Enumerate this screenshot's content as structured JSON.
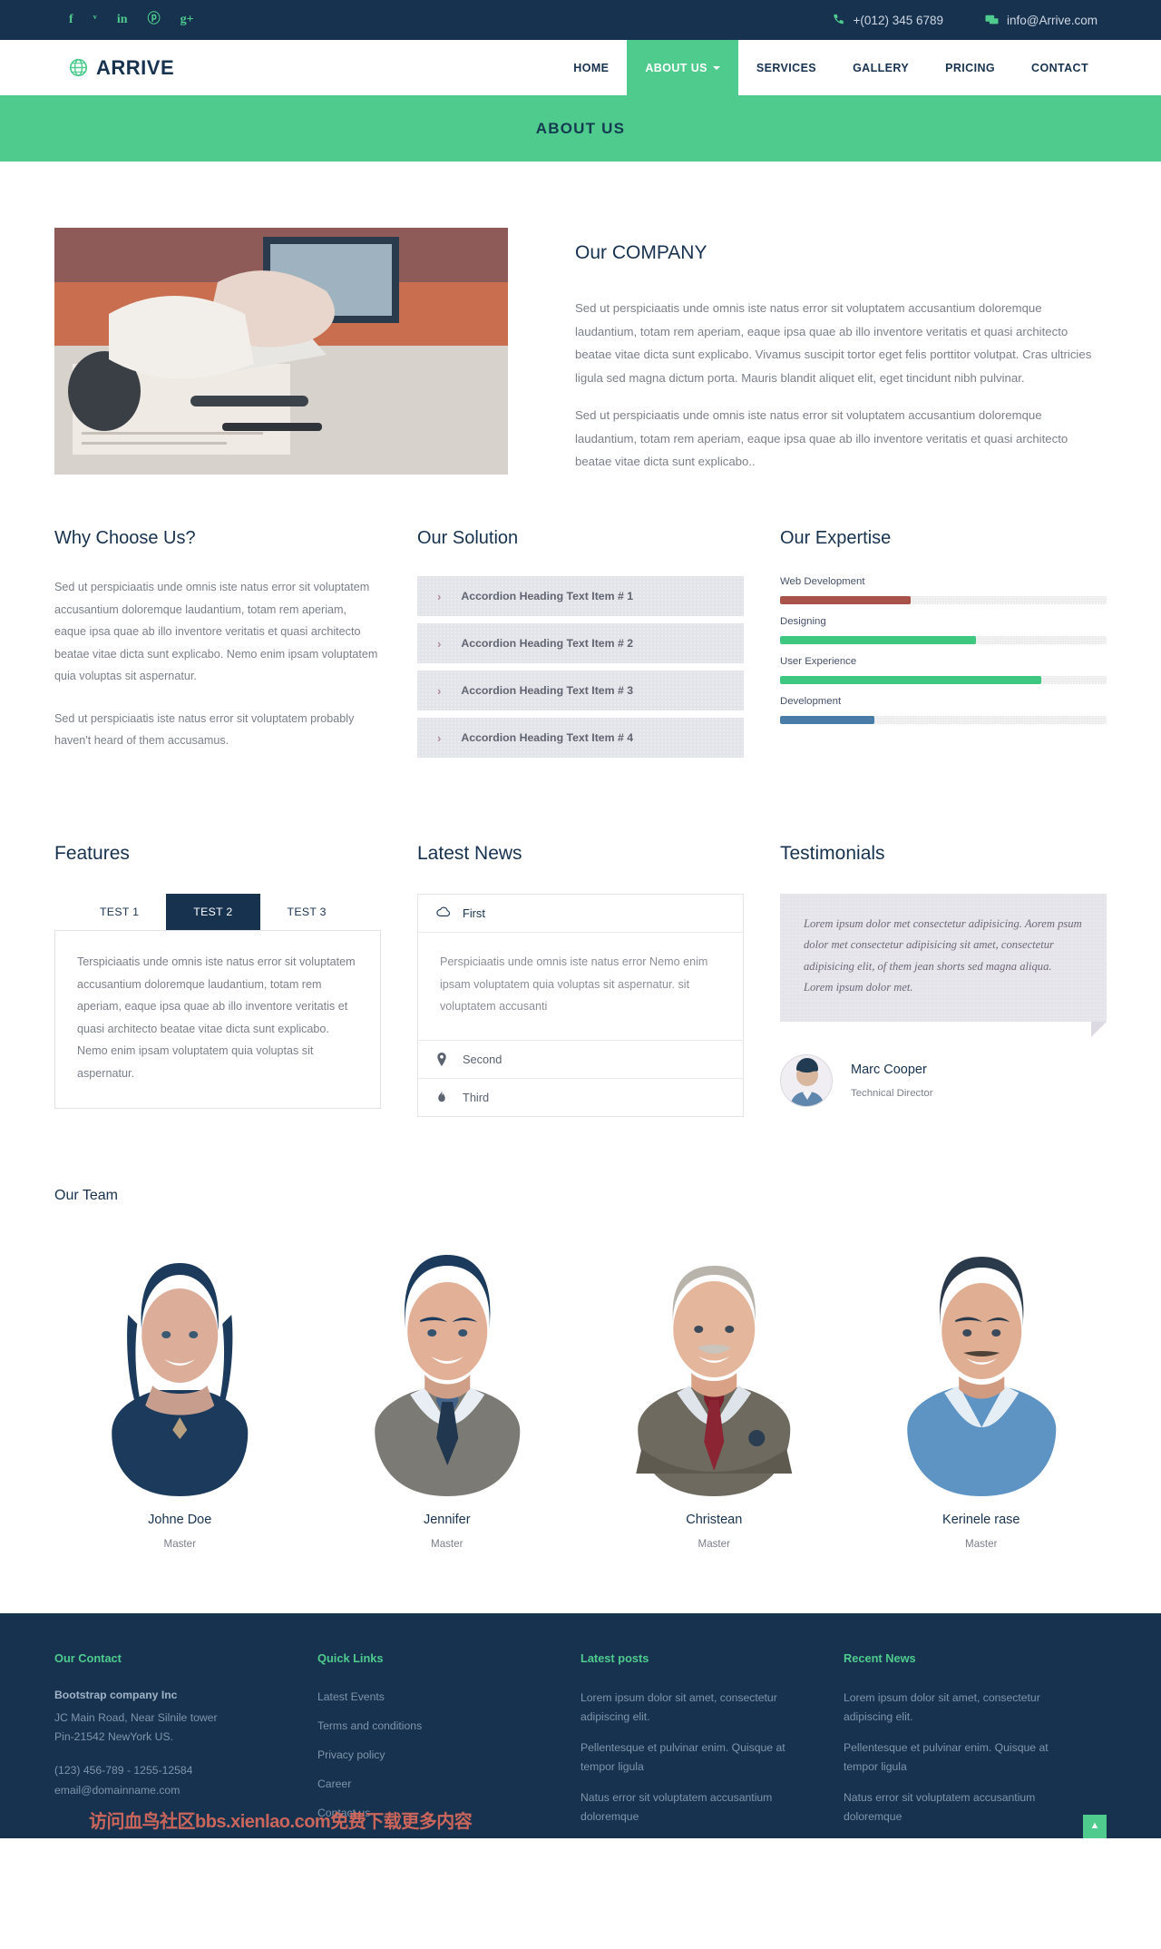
{
  "topbar": {
    "social": [
      {
        "name": "facebook-icon",
        "glyph": "f"
      },
      {
        "name": "twitter-icon",
        "glyph": "ᵛ"
      },
      {
        "name": "linkedin-icon",
        "glyph": "in"
      },
      {
        "name": "pinterest-icon",
        "glyph": "ⓟ"
      },
      {
        "name": "googleplus-icon",
        "glyph": "g+"
      }
    ],
    "phone": "+(012) 345 6789",
    "email": "info@Arrive.com",
    "phone_icon": "phone-icon",
    "email_icon": "message-icon"
  },
  "navbar": {
    "brand": "ARRIVE",
    "brand_icon": "globe-icon",
    "menu": [
      {
        "label": "HOME",
        "active": false,
        "caret": false
      },
      {
        "label": "ABOUT US",
        "active": true,
        "caret": true
      },
      {
        "label": "SERVICES",
        "active": false,
        "caret": false
      },
      {
        "label": "GALLERY",
        "active": false,
        "caret": false
      },
      {
        "label": "PRICING",
        "active": false,
        "caret": false
      },
      {
        "label": "CONTACT",
        "active": false,
        "caret": false
      }
    ]
  },
  "banner": {
    "title": "ABOUT US"
  },
  "company": {
    "title": "Our COMPANY",
    "paragraph1": "Sed ut perspiciaatis unde omnis iste natus error sit voluptatem accusantium doloremque laudantium, totam rem aperiam, eaque ipsa quae ab illo inventore veritatis et quasi architecto beatae vitae dicta sunt explicabo. Vivamus suscipit tortor eget felis porttitor volutpat. Cras ultricies ligula sed magna dictum porta. Mauris blandit aliquet elit, eget tincidunt nibh pulvinar.",
    "paragraph2": "Sed ut perspiciaatis unde omnis iste natus error sit voluptatem accusantium doloremque laudantium, totam rem aperiam, eaque ipsa quae ab illo inventore veritatis et quasi architecto beatae vitae dicta sunt explicabo.."
  },
  "why": {
    "title": "Why Choose Us?",
    "paragraph1": "Sed ut perspiciaatis unde omnis iste natus error sit voluptatem accusantium doloremque laudantium, totam rem aperiam, eaque ipsa quae ab illo inventore veritatis et quasi architecto beatae vitae dicta sunt explicabo. Nemo enim ipsam voluptatem quia voluptas sit aspernatur.",
    "paragraph2": "Sed ut perspiciaatis iste natus error sit voluptatem probably haven't heard of them accusamus."
  },
  "solution": {
    "title": "Our Solution",
    "items": [
      "Accordion Heading Text Item # 1",
      "Accordion Heading Text Item # 2",
      "Accordion Heading Text Item # 3",
      "Accordion Heading Text Item # 4"
    ]
  },
  "expertise": {
    "title": "Our Expertise",
    "skills": [
      {
        "name": "Web Development",
        "value": 40,
        "color": "#a9524a"
      },
      {
        "name": "Designing",
        "value": 60,
        "color": "#3ec77e"
      },
      {
        "name": "User Experience",
        "value": 80,
        "color": "#3ec77e"
      },
      {
        "name": "Development",
        "value": 29,
        "color": "#4a7ca8"
      }
    ]
  },
  "features": {
    "title": "Features",
    "tabs": [
      {
        "label": "TEST 1",
        "active": false
      },
      {
        "label": "TEST 2",
        "active": true
      },
      {
        "label": "TEST 3",
        "active": false
      }
    ],
    "panel_text": "Terspiciaatis unde omnis iste natus error sit voluptatem accusantium doloremque laudantium, totam rem aperiam, eaque ipsa quae ab illo inventore veritatis et quasi architecto beatae vitae dicta sunt explicabo. Nemo enim ipsam voluptatem quia voluptas sit aspernatur."
  },
  "latest_news": {
    "title": "Latest News",
    "items": [
      {
        "label": "First",
        "icon": "cloud-icon",
        "open": true,
        "body": "Perspiciaatis unde omnis iste natus error Nemo enim ipsam voluptatem quia voluptas sit aspernatur. sit voluptatem accusanti"
      },
      {
        "label": "Second",
        "icon": "map-pin-icon",
        "open": false,
        "body": ""
      },
      {
        "label": "Third",
        "icon": "fire-icon",
        "open": false,
        "body": ""
      }
    ]
  },
  "testimonials": {
    "title": "Testimonials",
    "quote": "Lorem ipsum dolor met consectetur adipisicing. Aorem psum dolor met consectetur adipisicing sit amet, consectetur adipisicing elit, of them jean shorts sed magna aliqua. Lorem ipsum dolor met.",
    "author_name": "Marc Cooper",
    "author_role": "Technical Director"
  },
  "team": {
    "title": "Our Team",
    "members": [
      {
        "name": "Johne Doe",
        "role": "Master"
      },
      {
        "name": "Jennifer",
        "role": "Master"
      },
      {
        "name": "Christean",
        "role": "Master"
      },
      {
        "name": "Kerinele rase",
        "role": "Master"
      }
    ]
  },
  "footer": {
    "contact": {
      "title": "Our Contact",
      "company": "Bootstrap company Inc",
      "address1": "JC Main Road, Near Silnile tower",
      "address2": "Pin-21542 NewYork US.",
      "phone": "(123) 456-789 - 1255-12584",
      "email": "email@domainname.com"
    },
    "quick_links": {
      "title": "Quick Links",
      "links": [
        "Latest Events",
        "Terms and conditions",
        "Privacy policy",
        "Career",
        "Contact us"
      ]
    },
    "latest_posts": {
      "title": "Latest posts",
      "posts": [
        "Lorem ipsum dolor sit amet, consectetur adipiscing elit.",
        "Pellentesque et pulvinar enim. Quisque at tempor ligula",
        "Natus error sit voluptatem accusantium doloremque"
      ]
    },
    "recent_news": {
      "title": "Recent News",
      "posts": [
        "Lorem ipsum dolor sit amet, consectetur adipiscing elit.",
        "Pellentesque et pulvinar enim. Quisque at tempor ligula",
        "Natus error sit voluptatem accusantium doloremque"
      ]
    },
    "watermark": "访问血鸟社区bbs.xienlao.com免费下载更多内容",
    "to_top_icon": "chevron-up-icon"
  },
  "colors": {
    "accent_green": "#4ecb8d",
    "dark_navy": "#17324f"
  }
}
